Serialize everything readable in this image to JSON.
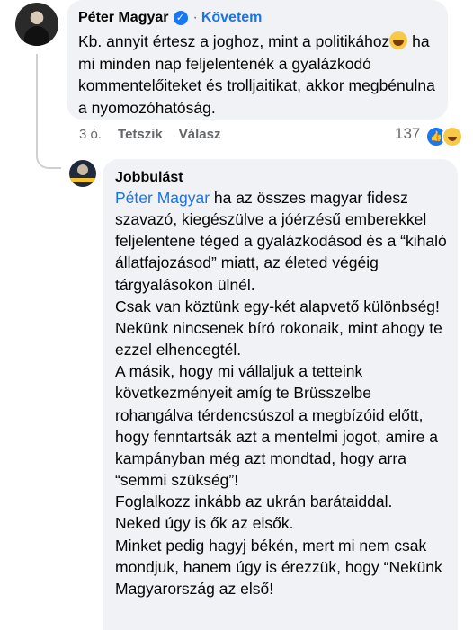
{
  "comment": {
    "author": "Péter Magyar",
    "separator": "·",
    "follow_label": "Követem",
    "text": "Kb. annyit értesz a joghoz, mint a politikához",
    "text_after_emoji": " ha mi minden nap feljelentenék a gyalázkodó kommentelőiteket és trolljaitikat, akkor megbénulna a nyomozóhatóság.",
    "emoji": "laughing-crying",
    "time": "3 ó.",
    "like_label": "Tetszik",
    "reply_label": "Válasz",
    "reaction_count": "137",
    "reactions": [
      "like",
      "haha"
    ]
  },
  "reply": {
    "author": "Jobbulást",
    "mention": "Péter Magyar",
    "text": " ha az összes magyar fidesz szavazó, kiegészülve a jóérzésű emberekkel feljelentene téged a gyalázkodásod és a “kihaló állatfajozásod” miatt, az életed végéig tárgyalásokon ülnél.\nCsak van köztünk egy-két alapvető különbség!\nNekünk nincsenek bíró rokonaik, mint ahogy te ezzel elhencegtél.\nA másik, hogy mi vállaljuk a tetteink következményeit amíg te Brüsszelbe rohangálva térdencsúszol a megbízóid előtt, hogy fenntartsák azt a mentelmi jogot, amire a kampányban még azt mondtad, hogy arra “semmi szükség”!\nFoglalkozz inkább az ukrán barátaiddal.\nNeked úgy is ők az elsők.\nMinket pedig hagyj békén, mert mi nem csak mondjuk, hanem úgy is érezzük, hogy “Nekünk Magyarország az első!"
  },
  "colors": {
    "bubble": "#f0f2f5",
    "link": "#1b74e4",
    "meta": "#65676b",
    "text": "#050505"
  }
}
